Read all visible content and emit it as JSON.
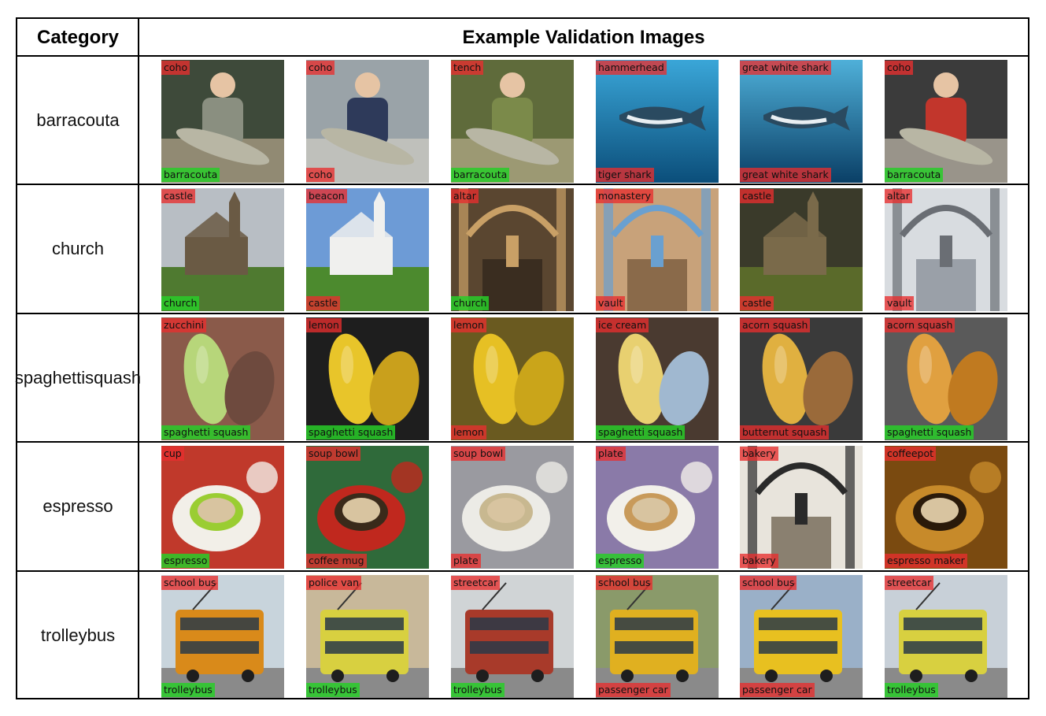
{
  "header": {
    "category_label": "Category",
    "images_label": "Example Validation Images"
  },
  "label_colors": {
    "top": "#e82e2e",
    "correct": "#28cd28",
    "incorrect": "#e82e2e"
  },
  "rows": [
    {
      "category": "barracouta",
      "images": [
        {
          "top": "coho",
          "bottom": "barracouta",
          "bottom_correct": true,
          "scene": "person-fish",
          "palette": [
            "#3e4a3a",
            "#8a8f80",
            "#c9b59a"
          ]
        },
        {
          "top": "coho",
          "bottom": "coho",
          "bottom_correct": false,
          "scene": "person-fish",
          "palette": [
            "#9aa3a8",
            "#2e3a5a",
            "#d9d4c8"
          ]
        },
        {
          "top": "tench",
          "bottom": "barracouta",
          "bottom_correct": true,
          "scene": "person-fish",
          "palette": [
            "#5f6b3b",
            "#7b8a4a",
            "#c4b89a"
          ]
        },
        {
          "top": "hammerhead",
          "bottom": "tiger shark",
          "bottom_correct": false,
          "scene": "underwater",
          "palette": [
            "#1d7fb5",
            "#3aa6d8",
            "#0b4e7a"
          ]
        },
        {
          "top": "great white shark",
          "bottom": "great white shark",
          "bottom_correct": false,
          "scene": "underwater",
          "palette": [
            "#0e6ea0",
            "#4fb0d9",
            "#0a3f66"
          ]
        },
        {
          "top": "coho",
          "bottom": "barracouta",
          "bottom_correct": true,
          "scene": "person-fish",
          "palette": [
            "#3b3b3b",
            "#c2362c",
            "#d8d0c0"
          ]
        }
      ]
    },
    {
      "category": "church",
      "images": [
        {
          "top": "castle",
          "bottom": "church",
          "bottom_correct": true,
          "scene": "building",
          "palette": [
            "#b8bec4",
            "#6a5a44",
            "#4f7a30"
          ]
        },
        {
          "top": "beacon",
          "bottom": "castle",
          "bottom_correct": false,
          "scene": "building",
          "palette": [
            "#6d9bd6",
            "#f0f0ee",
            "#4c8a2e"
          ]
        },
        {
          "top": "altar",
          "bottom": "church",
          "bottom_correct": true,
          "scene": "interior",
          "palette": [
            "#5a4630",
            "#3a2d20",
            "#c9a066"
          ]
        },
        {
          "top": "monastery",
          "bottom": "vault",
          "bottom_correct": false,
          "scene": "interior",
          "palette": [
            "#c8a27a",
            "#8a6a4a",
            "#6aa0d0"
          ]
        },
        {
          "top": "castle",
          "bottom": "castle",
          "bottom_correct": false,
          "scene": "building",
          "palette": [
            "#3a3a2a",
            "#7a6a4a",
            "#5a6a2a"
          ]
        },
        {
          "top": "altar",
          "bottom": "vault",
          "bottom_correct": false,
          "scene": "interior",
          "palette": [
            "#d8dce0",
            "#9aa0a8",
            "#6a6e74"
          ]
        }
      ]
    },
    {
      "category": "spaghetti squash",
      "category_lines": [
        "spaghetti",
        "squash"
      ],
      "images": [
        {
          "top": "zucchini",
          "bottom": "spaghetti squash",
          "bottom_correct": true,
          "scene": "squash",
          "palette": [
            "#8a5a4a",
            "#b7d67a",
            "#6e4a3e"
          ]
        },
        {
          "top": "lemon",
          "bottom": "spaghetti squash",
          "bottom_correct": true,
          "scene": "squash",
          "palette": [
            "#1e1e1e",
            "#e8c52a",
            "#c9a01c"
          ]
        },
        {
          "top": "lemon",
          "bottom": "lemon",
          "bottom_correct": false,
          "scene": "squash",
          "palette": [
            "#6a5a20",
            "#e6c024",
            "#caa51a"
          ]
        },
        {
          "top": "ice cream",
          "bottom": "spaghetti squash",
          "bottom_correct": true,
          "scene": "squash",
          "palette": [
            "#4a3a30",
            "#e8d070",
            "#a0b8d0"
          ]
        },
        {
          "top": "acorn squash",
          "bottom": "butternut squash",
          "bottom_correct": false,
          "scene": "squash",
          "palette": [
            "#3a3a3a",
            "#e0b040",
            "#9a6a3a"
          ]
        },
        {
          "top": "acorn squash",
          "bottom": "spaghetti squash",
          "bottom_correct": true,
          "scene": "squash",
          "palette": [
            "#5a5a5a",
            "#e0a040",
            "#c07a20"
          ]
        }
      ]
    },
    {
      "category": "espresso",
      "images": [
        {
          "top": "cup",
          "bottom": "espresso",
          "bottom_correct": true,
          "scene": "cup",
          "palette": [
            "#c0392b",
            "#f2efe8",
            "#9acd32"
          ]
        },
        {
          "top": "soup bowl",
          "bottom": "coffee mug",
          "bottom_correct": false,
          "scene": "cup",
          "palette": [
            "#2f6a3a",
            "#c0281e",
            "#3a2a1a"
          ]
        },
        {
          "top": "soup bowl",
          "bottom": "plate",
          "bottom_correct": false,
          "scene": "cup",
          "palette": [
            "#9a9aa0",
            "#ecebe6",
            "#c8b890"
          ]
        },
        {
          "top": "plate",
          "bottom": "espresso",
          "bottom_correct": true,
          "scene": "cup",
          "palette": [
            "#8a7aa8",
            "#f2f0ea",
            "#c89a5a"
          ]
        },
        {
          "top": "bakery",
          "bottom": "bakery",
          "bottom_correct": false,
          "scene": "interior",
          "palette": [
            "#e8e4dc",
            "#8a8070",
            "#2a2a2a"
          ]
        },
        {
          "top": "coffeepot",
          "bottom": "espresso maker",
          "bottom_correct": false,
          "scene": "cup",
          "palette": [
            "#7a4a10",
            "#c78a2a",
            "#2a1a0a"
          ]
        }
      ]
    },
    {
      "category": "trolleybus",
      "images": [
        {
          "top": "school bus",
          "bottom": "trolleybus",
          "bottom_correct": true,
          "scene": "bus",
          "palette": [
            "#c8d4dc",
            "#d98a1a",
            "#5a5a5a"
          ]
        },
        {
          "top": "police van",
          "bottom": "trolleybus",
          "bottom_correct": true,
          "scene": "bus",
          "palette": [
            "#c8b89a",
            "#d8d040",
            "#6a6a6a"
          ]
        },
        {
          "top": "streetcar",
          "bottom": "trolleybus",
          "bottom_correct": true,
          "scene": "bus",
          "palette": [
            "#d0d4d6",
            "#a83a2a",
            "#7a7a7a"
          ]
        },
        {
          "top": "school bus",
          "bottom": "passenger car",
          "bottom_correct": false,
          "scene": "bus",
          "palette": [
            "#8a9a6a",
            "#e0b020",
            "#3a3a3a"
          ]
        },
        {
          "top": "school bus",
          "bottom": "passenger car",
          "bottom_correct": false,
          "scene": "bus",
          "palette": [
            "#9ab0c8",
            "#e8c020",
            "#c0302a"
          ]
        },
        {
          "top": "streetcar",
          "bottom": "trolleybus",
          "bottom_correct": true,
          "scene": "bus",
          "palette": [
            "#c8d0d8",
            "#d8d040",
            "#9aa0a4"
          ]
        }
      ]
    }
  ]
}
